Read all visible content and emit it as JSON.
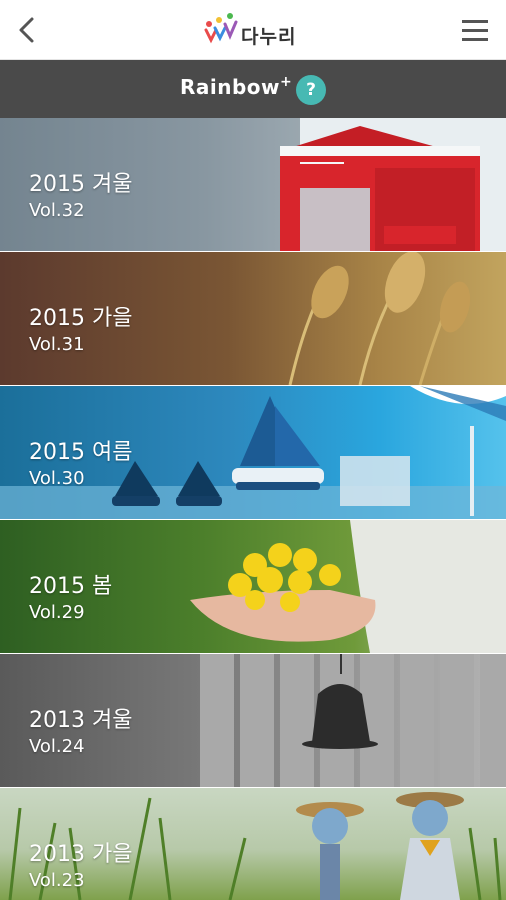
{
  "header": {
    "logo_text": "다누리",
    "rainbow_title": "Rainbow",
    "rainbow_plus": "+",
    "help_label": "?"
  },
  "issues": [
    {
      "season": "2015 겨울",
      "volume": "Vol.32",
      "illustration": "red-mailbox-in-snow"
    },
    {
      "season": "2015 가을",
      "volume": "Vol.31",
      "illustration": "wheat-ears"
    },
    {
      "season": "2015 여름",
      "volume": "Vol.30",
      "illustration": "toy-sailboats-and-deck-chair"
    },
    {
      "season": "2015 봄",
      "volume": "Vol.29",
      "illustration": "hands-holding-yellow-flowers"
    },
    {
      "season": "2013 겨울",
      "volume": "Vol.24",
      "illustration": "hat-on-wooden-fence"
    },
    {
      "season": "2013 가을",
      "volume": "Vol.23",
      "illustration": "scarecrows-in-grass"
    }
  ],
  "colors": {
    "topbar_bg": "#ffffff",
    "subbar_bg": "#4a4a4a",
    "help_badge": "#47b9b3",
    "card_text": "#ffffff"
  }
}
